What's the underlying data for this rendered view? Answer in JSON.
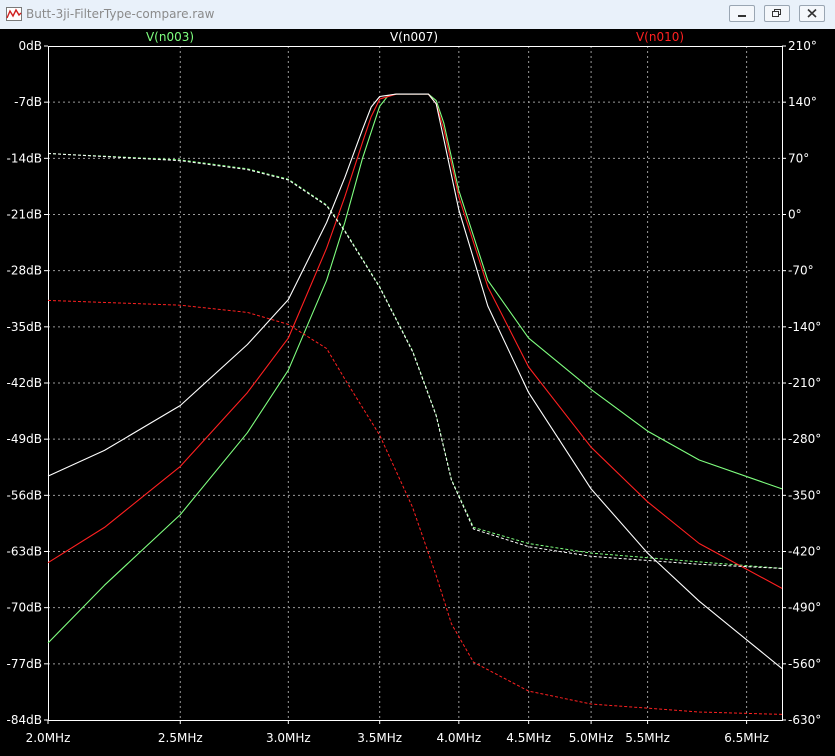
{
  "window": {
    "title": "Butt-3ji-FilterType-compare.raw",
    "controls": [
      "minimize",
      "restore",
      "close"
    ]
  },
  "chart_data": {
    "type": "line",
    "x_scale": "log",
    "x_unit": "Hz",
    "xlim": [
      2000000,
      6900000
    ],
    "ylim_left": [
      -84,
      0
    ],
    "ylim_right": [
      -630,
      210
    ],
    "x_ticks": [
      {
        "value": 2000000,
        "label": "2.0MHz"
      },
      {
        "value": 2500000,
        "label": "2.5MHz"
      },
      {
        "value": 3000000,
        "label": "3.0MHz"
      },
      {
        "value": 3500000,
        "label": "3.5MHz"
      },
      {
        "value": 4000000,
        "label": "4.0MHz"
      },
      {
        "value": 4500000,
        "label": "4.5MHz"
      },
      {
        "value": 5000000,
        "label": "5.0MHz"
      },
      {
        "value": 5500000,
        "label": "5.5MHz"
      },
      {
        "value": 6500000,
        "label": "6.5MHz"
      }
    ],
    "y_left_ticks": [
      {
        "value": 0,
        "label": "0dB"
      },
      {
        "value": -7,
        "label": "-7dB"
      },
      {
        "value": -14,
        "label": "-14dB"
      },
      {
        "value": -21,
        "label": "-21dB"
      },
      {
        "value": -28,
        "label": "-28dB"
      },
      {
        "value": -35,
        "label": "-35dB"
      },
      {
        "value": -42,
        "label": "-42dB"
      },
      {
        "value": -49,
        "label": "-49dB"
      },
      {
        "value": -56,
        "label": "-56dB"
      },
      {
        "value": -63,
        "label": "-63dB"
      },
      {
        "value": -70,
        "label": "-70dB"
      },
      {
        "value": -77,
        "label": "-77dB"
      },
      {
        "value": -84,
        "label": "-84dB"
      }
    ],
    "y_right_ticks": [
      {
        "value": 210,
        "label": "210°"
      },
      {
        "value": 140,
        "label": "140°"
      },
      {
        "value": 70,
        "label": "70°"
      },
      {
        "value": 0,
        "label": "0°"
      },
      {
        "value": -70,
        "label": "-70°"
      },
      {
        "value": -140,
        "label": "-140°"
      },
      {
        "value": -210,
        "label": "-210°"
      },
      {
        "value": -280,
        "label": "-280°"
      },
      {
        "value": -350,
        "label": "-350°"
      },
      {
        "value": -420,
        "label": "-420°"
      },
      {
        "value": -490,
        "label": "-490°"
      },
      {
        "value": -560,
        "label": "-560°"
      },
      {
        "value": -630,
        "label": "-630°"
      }
    ],
    "grid": true,
    "legend_placement": "top",
    "series": [
      {
        "name": "V(n003)",
        "color": "#7fff7f",
        "magnitude_db": [
          [
            2000000,
            -74.4
          ],
          [
            2200000,
            -67.2
          ],
          [
            2500000,
            -58.4
          ],
          [
            2800000,
            -48.2
          ],
          [
            3000000,
            -40.4
          ],
          [
            3200000,
            -29.2
          ],
          [
            3300000,
            -22.0
          ],
          [
            3400000,
            -14.0
          ],
          [
            3500000,
            -7.5
          ],
          [
            3550000,
            -6.2
          ],
          [
            3600000,
            -6.0
          ],
          [
            3800000,
            -6.0
          ],
          [
            3850000,
            -6.8
          ],
          [
            3900000,
            -9.6
          ],
          [
            4000000,
            -18.0
          ],
          [
            4200000,
            -29.2
          ],
          [
            4500000,
            -36.4
          ],
          [
            5000000,
            -42.8
          ],
          [
            5500000,
            -48.0
          ],
          [
            6000000,
            -51.6
          ],
          [
            6900000,
            -55.2
          ]
        ],
        "phase_deg": [
          [
            2000000,
            76
          ],
          [
            2500000,
            68
          ],
          [
            2800000,
            57
          ],
          [
            3000000,
            44
          ],
          [
            3200000,
            12
          ],
          [
            3300000,
            -20
          ],
          [
            3500000,
            -90
          ],
          [
            3700000,
            -170
          ],
          [
            3850000,
            -250
          ],
          [
            3950000,
            -330
          ],
          [
            4100000,
            -390
          ],
          [
            4500000,
            -410
          ],
          [
            5000000,
            -422
          ],
          [
            6000000,
            -433
          ],
          [
            6900000,
            -441
          ]
        ]
      },
      {
        "name": "V(n007)",
        "color": "#ffffff",
        "magnitude_db": [
          [
            2000000,
            -53.6
          ],
          [
            2200000,
            -50.4
          ],
          [
            2500000,
            -44.8
          ],
          [
            2800000,
            -37.2
          ],
          [
            3000000,
            -31.6
          ],
          [
            3200000,
            -22.0
          ],
          [
            3300000,
            -16.4
          ],
          [
            3400000,
            -10.4
          ],
          [
            3450000,
            -7.6
          ],
          [
            3500000,
            -6.3
          ],
          [
            3600000,
            -6.0
          ],
          [
            3800000,
            -6.0
          ],
          [
            3850000,
            -7.2
          ],
          [
            3900000,
            -11.6
          ],
          [
            4000000,
            -20.4
          ],
          [
            4200000,
            -32.4
          ],
          [
            4500000,
            -43.2
          ],
          [
            5000000,
            -55.2
          ],
          [
            5500000,
            -63.2
          ],
          [
            6000000,
            -69.2
          ],
          [
            6900000,
            -77.6
          ]
        ],
        "phase_deg": [
          [
            2000000,
            76
          ],
          [
            2500000,
            67
          ],
          [
            2800000,
            56
          ],
          [
            3000000,
            43
          ],
          [
            3200000,
            11
          ],
          [
            3300000,
            -21
          ],
          [
            3500000,
            -91
          ],
          [
            3700000,
            -171
          ],
          [
            3850000,
            -251
          ],
          [
            3950000,
            -331
          ],
          [
            4100000,
            -392
          ],
          [
            4500000,
            -414
          ],
          [
            5000000,
            -426
          ],
          [
            6000000,
            -436
          ],
          [
            6900000,
            -441
          ]
        ]
      },
      {
        "name": "V(n010)",
        "color": "#ff2020",
        "magnitude_db": [
          [
            2000000,
            -64.4
          ],
          [
            2200000,
            -60.0
          ],
          [
            2500000,
            -52.4
          ],
          [
            2800000,
            -43.2
          ],
          [
            3000000,
            -36.4
          ],
          [
            3200000,
            -25.2
          ],
          [
            3300000,
            -18.8
          ],
          [
            3400000,
            -12.0
          ],
          [
            3450000,
            -8.8
          ],
          [
            3500000,
            -6.6
          ],
          [
            3600000,
            -6.0
          ],
          [
            3800000,
            -6.0
          ],
          [
            3850000,
            -7.2
          ],
          [
            3900000,
            -10.4
          ],
          [
            4000000,
            -18.8
          ],
          [
            4200000,
            -30.0
          ],
          [
            4500000,
            -40.0
          ],
          [
            5000000,
            -50.0
          ],
          [
            5500000,
            -56.8
          ],
          [
            6000000,
            -62.0
          ],
          [
            6900000,
            -67.6
          ]
        ],
        "phase_deg": [
          [
            2000000,
            -107
          ],
          [
            2500000,
            -113
          ],
          [
            2800000,
            -122
          ],
          [
            3000000,
            -137
          ],
          [
            3200000,
            -167
          ],
          [
            3300000,
            -205
          ],
          [
            3500000,
            -275
          ],
          [
            3700000,
            -365
          ],
          [
            3850000,
            -450
          ],
          [
            3950000,
            -510
          ],
          [
            4100000,
            -558
          ],
          [
            4500000,
            -594
          ],
          [
            5000000,
            -610
          ],
          [
            6000000,
            -620
          ],
          [
            6900000,
            -623
          ]
        ]
      }
    ]
  }
}
